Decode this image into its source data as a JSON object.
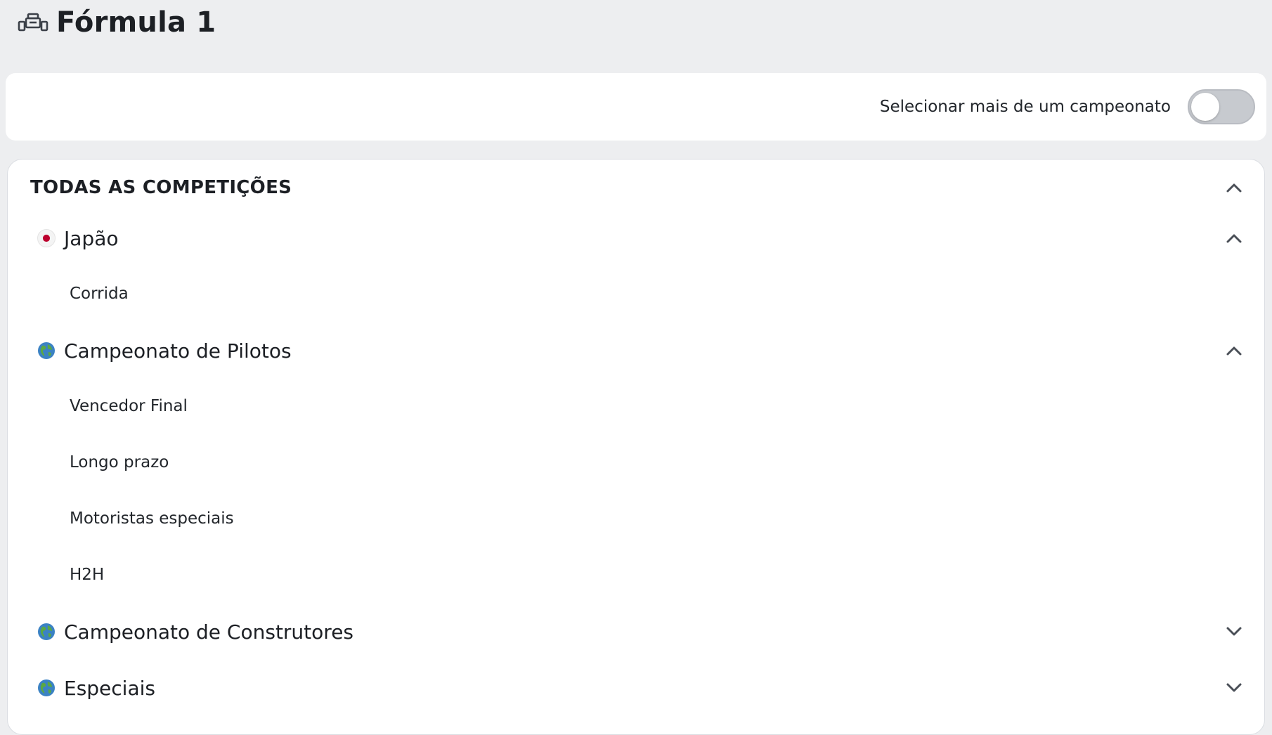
{
  "header": {
    "title": "Fórmula 1",
    "icon": "formula-car-icon"
  },
  "multi_select": {
    "label": "Selecionar mais de um campeonato",
    "enabled": false
  },
  "competitions": {
    "title": "TODAS AS COMPETIÇÕES",
    "expanded": true,
    "groups": [
      {
        "label": "Japão",
        "icon": "japan-flag-icon",
        "expanded": true,
        "items": [
          "Corrida"
        ]
      },
      {
        "label": "Campeonato de Pilotos",
        "icon": "globe-icon",
        "expanded": true,
        "items": [
          "Vencedor Final",
          "Longo prazo",
          "Motoristas especiais",
          "H2H"
        ]
      },
      {
        "label": "Campeonato de Construtores",
        "icon": "globe-icon",
        "expanded": false,
        "items": []
      },
      {
        "label": "Especiais",
        "icon": "globe-icon",
        "expanded": false,
        "items": []
      }
    ]
  },
  "colors": {
    "background": "#edeef0",
    "card": "#ffffff",
    "text": "#1c1f24",
    "toggle_off": "#c7cacf",
    "japan_red": "#bc002d",
    "globe_blue": "#3b82c4",
    "globe_green": "#5aa844"
  }
}
